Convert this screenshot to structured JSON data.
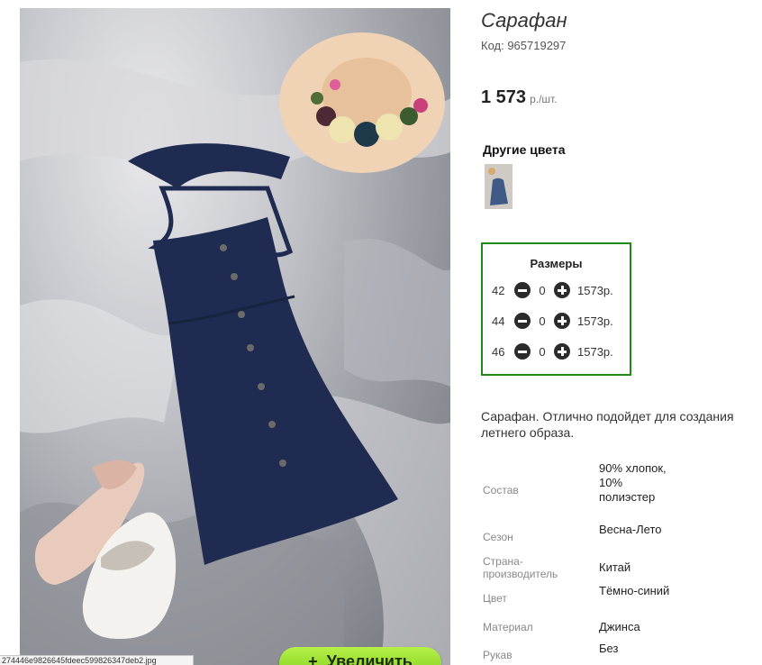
{
  "product": {
    "title": "Сарафан",
    "code": "Код: 965719297",
    "price": "1 573",
    "price_unit": "р./шт."
  },
  "other_colors": {
    "title": "Другие цвета"
  },
  "sizes": {
    "title": "Размеры",
    "rows": [
      {
        "size": "42",
        "qty": "0",
        "price": "1573р."
      },
      {
        "size": "44",
        "qty": "0",
        "price": "1573р."
      },
      {
        "size": "46",
        "qty": "0",
        "price": "1573р."
      }
    ]
  },
  "description": "Сарафан. Отлично подойдет для создания летнего образа.",
  "specs": [
    {
      "label": "Состав",
      "value": "90% хлопок, 10% полиэстер"
    },
    {
      "label": "Сезон",
      "value": "Весна-Лето"
    },
    {
      "label": "Страна-производитель",
      "value": "Китай"
    },
    {
      "label": "Цвет",
      "value": "Тёмно-синий"
    },
    {
      "label": "Материал",
      "value": "Джинса"
    },
    {
      "label": "Рукав",
      "value": "Без"
    }
  ],
  "zoom_button": {
    "label": "Увеличить",
    "icon": "plus-icon"
  },
  "status_bar": {
    "file": "274446e9826645fdeec599826347deb2.jpg"
  },
  "colors": {
    "accent_green": "#1f8a17",
    "zoom_green": "#8fd626",
    "dress_navy": "#1f2b50"
  }
}
